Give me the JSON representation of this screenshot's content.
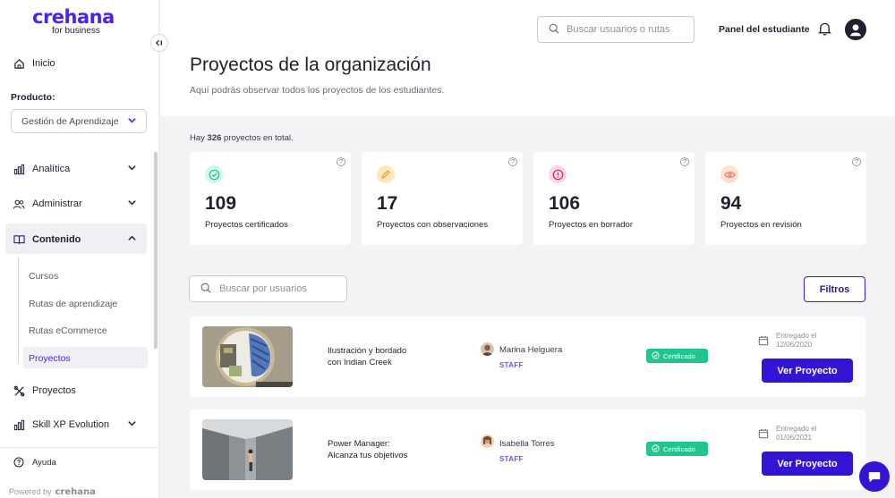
{
  "brand": {
    "logo": "crehana",
    "subtitle": "for business"
  },
  "sidebar": {
    "home": "Inicio",
    "product_label": "Producto:",
    "product_value": "Gestión de Aprendizaje",
    "analytics": "Analítica",
    "admin": "Administrar",
    "content": "Contenido",
    "sub_items": [
      "Cursos",
      "Rutas de aprendizaje",
      "Rutas eCommerce",
      "Proyectos"
    ],
    "projects": "Proyectos",
    "skill_xp": "Skill XP Evolution",
    "help": "Ayuda",
    "powered_by": "Powered by",
    "powered_brand": "crehana"
  },
  "header": {
    "search_placeholder": "Buscar usuarios o rutas",
    "panel_link": "Panel del estudiante",
    "title": "Proyectos de la organización",
    "subtitle": "Aquí podrás observar todos los proyectos de los estudiantes."
  },
  "summary": {
    "prefix": "Hay",
    "count": "326",
    "suffix": "proyectos en total."
  },
  "stats": [
    {
      "value": "109",
      "label": "Proyectos certificados",
      "color": "#21c48f"
    },
    {
      "value": "17",
      "label": "Proyectos con observaciones",
      "color": "#f5a623"
    },
    {
      "value": "106",
      "label": "Proyectos en borrador",
      "color": "#e0245e"
    },
    {
      "value": "94",
      "label": "Proyectos en revisión",
      "color": "#f06a4a"
    }
  ],
  "filters": {
    "search_placeholder": "Buscar por usuarios",
    "button": "Filtros"
  },
  "projects": [
    {
      "title_line1": "Ilustración y bordado",
      "title_line2": "con Indian Creek",
      "user": "Marina Helguera",
      "role": "STAFF",
      "status": "Certificado",
      "delivered_label": "Entregado el",
      "delivered_date": "12/06/2020",
      "action": "Ver Proyecto"
    },
    {
      "title_line1": "Power Manager:",
      "title_line2": "Alcanza tus objetivos",
      "user": "Isabella Torres",
      "role": "STAFF",
      "status": "Certificado",
      "delivered_label": "Entregado el",
      "delivered_date": "01/06/2021",
      "action": "Ver Proyecto"
    }
  ],
  "colors": {
    "brand": "#4b22f4",
    "primary_button": "#3514d6",
    "certified": "#21c48f"
  }
}
